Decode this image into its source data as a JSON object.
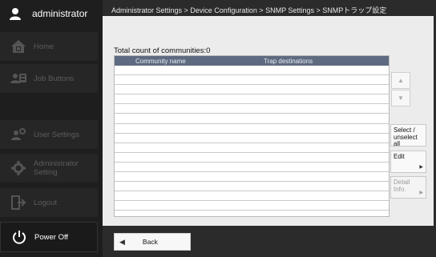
{
  "user": {
    "name": "administrator",
    "icon": "user-icon"
  },
  "nav": {
    "home": "Home",
    "job_buttons": "Job Buttons",
    "user_settings": "User Settings",
    "admin_settings": [
      "Administrator",
      "Setting"
    ],
    "logout": "Logout",
    "power_off": "Power Off"
  },
  "breadcrumb": "Administrator Settings > Device Configuration > SNMP Settings > SNMPトラップ設定",
  "total_count": "Total count of communities:0",
  "table": {
    "columns": [
      "Community name",
      "Trap destinations"
    ],
    "rows": []
  },
  "scroll": {
    "up": "▲",
    "down": "▼"
  },
  "buttons": {
    "select_all": [
      "Select /",
      "unselect all"
    ],
    "edit": "Edit",
    "detail_info": "Detail Info.",
    "arrow": "▶",
    "back": "Back",
    "back_arrow": "◀"
  }
}
